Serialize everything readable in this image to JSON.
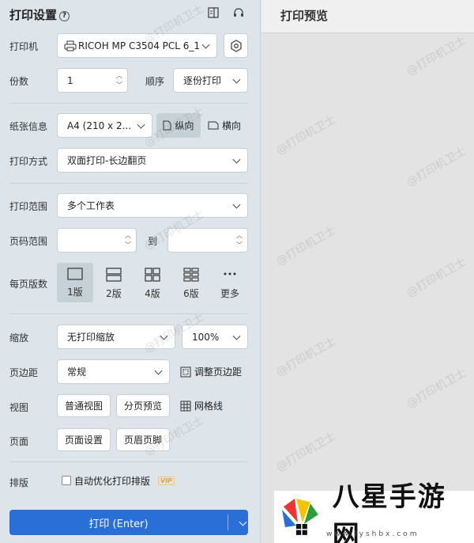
{
  "header": {
    "title": "打印设置",
    "help_icon": "?"
  },
  "preview": {
    "title": "打印预览"
  },
  "printer": {
    "label": "打印机",
    "value": "RICOH MP C3504 PCL 6_1"
  },
  "copies": {
    "label": "份数",
    "value": "1",
    "order_label": "顺序",
    "order_value": "逐份打印"
  },
  "paper": {
    "label": "纸张信息",
    "value": "A4 (210 x 2...",
    "portrait": "纵向",
    "landscape": "横向"
  },
  "print_mode": {
    "label": "打印方式",
    "value": "双面打印-长边翻页"
  },
  "range": {
    "label": "打印范围",
    "value": "多个工作表"
  },
  "page_range": {
    "label": "页码范围",
    "to": "到",
    "from_value": "",
    "to_value": ""
  },
  "per_page": {
    "label": "每页版数",
    "options": [
      "1版",
      "2版",
      "4版",
      "6版",
      "更多"
    ],
    "selected": 0
  },
  "scale": {
    "label": "缩放",
    "value": "无打印缩放",
    "percent": "100%"
  },
  "margin": {
    "label": "页边距",
    "value": "常规",
    "adjust": "调整页边距"
  },
  "view": {
    "label": "视图",
    "normal": "普通视图",
    "page_break": "分页预览",
    "gridlines": "网格线"
  },
  "page": {
    "label": "页面",
    "setup": "页面设置",
    "header_footer": "页眉页脚"
  },
  "layout": {
    "label": "排版",
    "auto": "自动优化打印排版",
    "vip": "VIP"
  },
  "print_button": {
    "label": "打印 (Enter)"
  },
  "watermark": {
    "text": "@打印机卫士"
  },
  "logo": {
    "name": "八星手游网",
    "url": "www.lyshbx.com"
  },
  "colors": {
    "accent": "#2a6fd8",
    "panel": "#dde5ea",
    "preview_bg": "#e3e3e3"
  }
}
